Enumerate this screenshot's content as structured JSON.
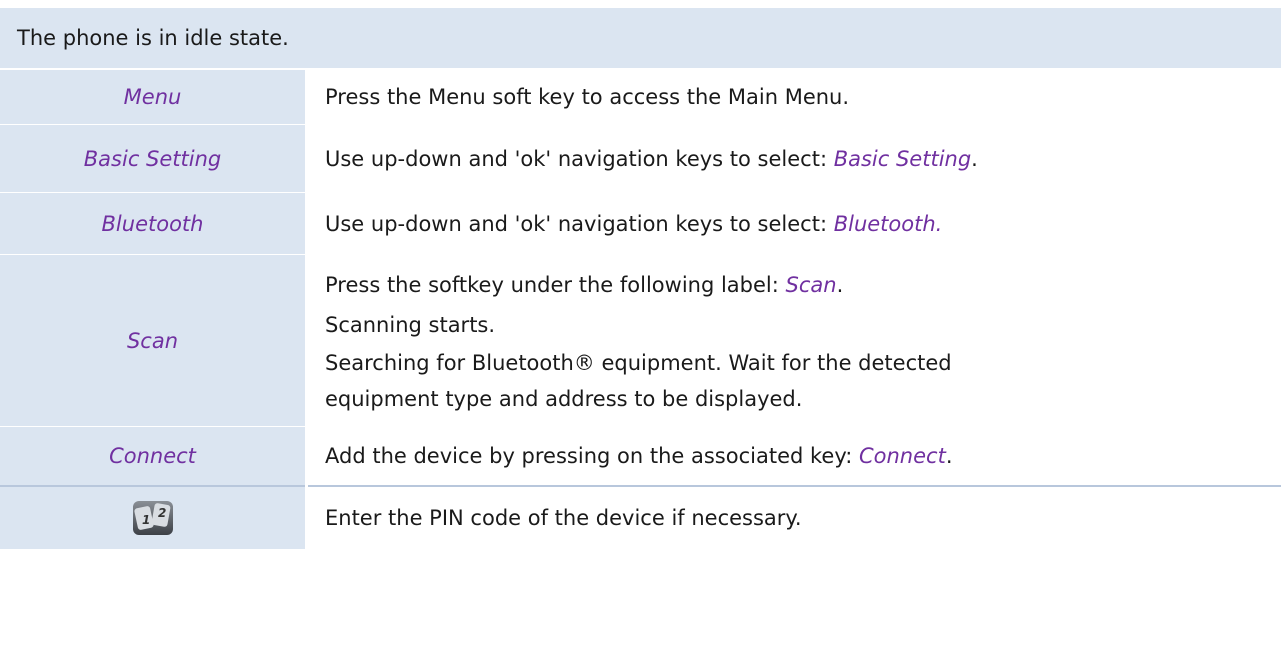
{
  "header": {
    "text": "The phone is in idle state."
  },
  "steps": [
    {
      "key": "Menu",
      "desc": "Press the Menu soft key to access the Main Menu."
    },
    {
      "key": "Basic Setting",
      "desc_prefix": "Use up-down and 'ok' navigation keys to select: ",
      "desc_hl": "Basic Setting",
      "desc_suffix": "."
    },
    {
      "key": "Bluetooth",
      "desc_prefix": "Use up-down and 'ok' navigation keys to select: ",
      "desc_hl": "Bluetooth.",
      "desc_suffix": ""
    },
    {
      "key": "Scan",
      "lines": {
        "l1_prefix": "Press the softkey under the following label: ",
        "l1_hl": "Scan",
        "l1_suffix": ".",
        "l2": "Scanning starts.",
        "l3": "Searching for Bluetooth® equipment. Wait for the detected",
        "l4": "equipment type and address to be displayed."
      }
    },
    {
      "key": "Connect",
      "desc_prefix": "Add the device by pressing on the associated key: ",
      "desc_hl": "Connect",
      "desc_suffix": "."
    },
    {
      "key_icon": "keypad-icon",
      "desc": "Enter the PIN code of the device if necessary."
    }
  ],
  "colors": {
    "header_bg": "#dbe5f1",
    "highlight": "#7030a0"
  }
}
